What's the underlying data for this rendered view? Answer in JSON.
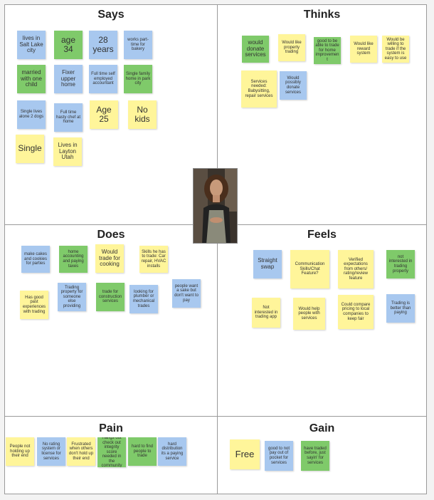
{
  "quadrants": [
    {
      "key": "says",
      "title": "Says"
    },
    {
      "key": "thinks",
      "title": "Thinks"
    },
    {
      "key": "does",
      "title": "Does"
    },
    {
      "key": "feels",
      "title": "Feels"
    },
    {
      "key": "pain",
      "title": "Pain"
    },
    {
      "key": "gain",
      "title": "Gain"
    }
  ],
  "notes": {
    "says": [
      {
        "text": "lives in Salt Lake city",
        "color": "blue"
      },
      {
        "text": "age 34",
        "color": "green"
      },
      {
        "text": "28 years",
        "color": "blue"
      },
      {
        "text": "works part-time for bakery",
        "color": "blue"
      },
      {
        "text": "married with one child",
        "color": "green"
      },
      {
        "text": "Fixer upper home",
        "color": "blue"
      },
      {
        "text": "Full time self employed accountant",
        "color": "blue"
      },
      {
        "text": "Single family home in park city",
        "color": "green"
      },
      {
        "text": "Single lives alone 2 dogs",
        "color": "blue"
      },
      {
        "text": "Full time hasty chef at home",
        "color": "blue"
      },
      {
        "text": "Age 25",
        "color": "yellow"
      },
      {
        "text": "No kids",
        "color": "yellow"
      },
      {
        "text": "Single",
        "color": "yellow"
      },
      {
        "text": "Lives in Layton Utah",
        "color": "yellow"
      }
    ],
    "thinks": [
      {
        "text": "would donate services",
        "color": "green"
      },
      {
        "text": "Would like property trading",
        "color": "yellow"
      },
      {
        "text": "good to be able to trade for home improvement",
        "color": "green"
      },
      {
        "text": "Would like reward system",
        "color": "yellow"
      },
      {
        "text": "Would be willing to trade if the system is easy to use",
        "color": "yellow"
      },
      {
        "text": "Services needed: Babysitting, repair services",
        "color": "yellow"
      },
      {
        "text": "Would possibly donate services",
        "color": "blue"
      }
    ],
    "does": [
      {
        "text": "make cakes and cookies for parties",
        "color": "blue"
      },
      {
        "text": "home accounting and paying taxes",
        "color": "green"
      },
      {
        "text": "Would trade for cooking",
        "color": "yellow"
      },
      {
        "text": "Skills he has to trade: Car repair, HVAC installs",
        "color": "yellow"
      },
      {
        "text": "Has good past experiences with trading",
        "color": "yellow"
      },
      {
        "text": "Trading property for someone else providing",
        "color": "blue"
      },
      {
        "text": "trade for construction services",
        "color": "green"
      },
      {
        "text": "looking for plumber or mechanical trades",
        "color": "blue"
      },
      {
        "text": "people want a sake but don't want to pay",
        "color": "blue"
      }
    ],
    "feels": [
      {
        "text": "Straight swap",
        "color": "blue"
      },
      {
        "text": "Communication Skills/Chat Feature?",
        "color": "yellow"
      },
      {
        "text": "Verified expectations from others/ rating/review feature",
        "color": "yellow"
      },
      {
        "text": "not interested in trading property",
        "color": "green"
      },
      {
        "text": "Not interested in trading app",
        "color": "yellow"
      },
      {
        "text": "Would help people with services",
        "color": "yellow"
      },
      {
        "text": "Could compare pricing to local companies to keep fair",
        "color": "yellow"
      },
      {
        "text": "Trading is better than paying",
        "color": "blue"
      }
    ],
    "pain": [
      {
        "text": "People not holding up their end",
        "color": "yellow"
      },
      {
        "text": "No rating system or license for services",
        "color": "blue"
      },
      {
        "text": "Frustrated when others don't hold up their end",
        "color": "yellow"
      },
      {
        "text": "Hangs out check out integrity score needed in the community",
        "color": "green"
      },
      {
        "text": "hard to find people to trade",
        "color": "green"
      },
      {
        "text": "hard distribution its a paying service",
        "color": "blue"
      }
    ],
    "gain": [
      {
        "text": "Free",
        "color": "yellow"
      },
      {
        "text": "good to not pay out of pocket for services",
        "color": "blue"
      },
      {
        "text": "have traded before, just sayin' for services",
        "color": "green"
      }
    ]
  },
  "photo": {
    "icon": "person-photo"
  }
}
